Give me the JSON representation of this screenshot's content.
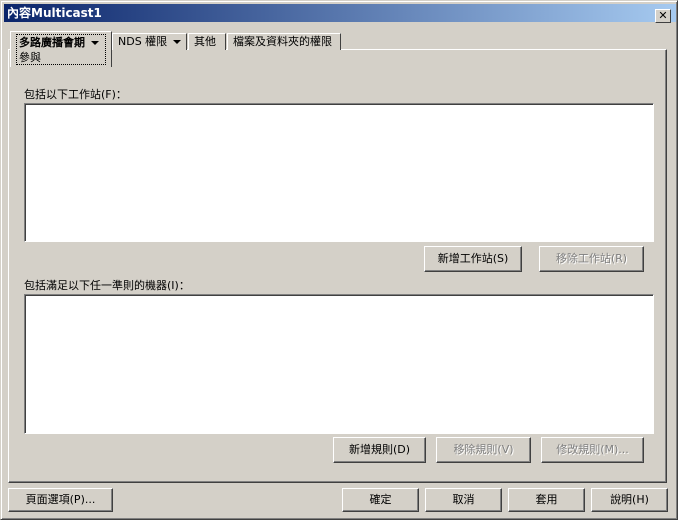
{
  "window": {
    "title": "內容Multicast1",
    "close_label": "✕"
  },
  "tabs": [
    {
      "label": "多路廣播會期",
      "sub": "參與",
      "has_menu": true,
      "active": true
    },
    {
      "label": "NDS 權限",
      "has_menu": true
    },
    {
      "label": "其他"
    },
    {
      "label": "檔案及資料夾的權限"
    }
  ],
  "workstations": {
    "label": "包括以下工作站(F)：",
    "add_button": "新增工作站(S)",
    "remove_button": "移除工作站(R)",
    "items": []
  },
  "rules": {
    "label": "包括滿足以下任一準則的機器(I)：",
    "add_button": "新增規則(D)",
    "remove_button": "移除規則(V)",
    "edit_button": "修改規則(M)...",
    "items": []
  },
  "footer": {
    "page_options": "頁面選項(P)...",
    "ok": "確定",
    "cancel": "取消",
    "apply": "套用",
    "help": "說明(H)"
  }
}
